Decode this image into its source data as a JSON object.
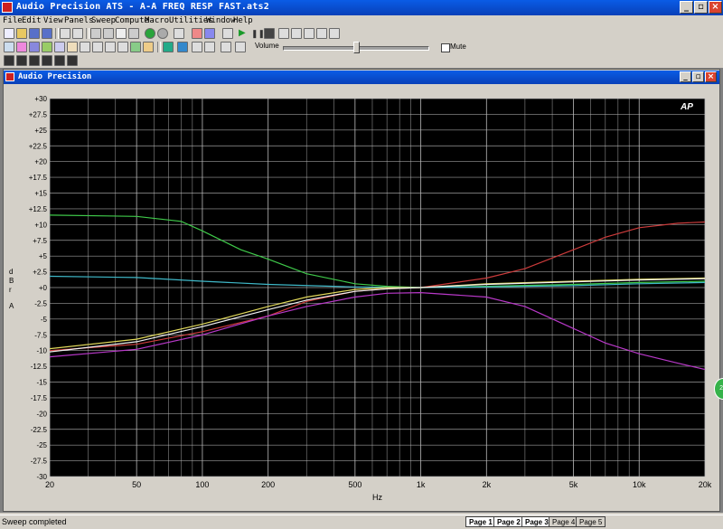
{
  "window": {
    "title": "Audio Precision ATS - A-A FREQ RESP FAST.ats2"
  },
  "menu": [
    "File",
    "Edit",
    "View",
    "Panels",
    "Sweep",
    "Compute",
    "Macro",
    "Utilities",
    "Window",
    "Help"
  ],
  "toolbar": {
    "volume_label": "Volume",
    "volume_level": 0.5,
    "mute_label": "Mute"
  },
  "child_window": {
    "title": "Audio Precision",
    "logo": "AP"
  },
  "status": {
    "text": "Sweep completed",
    "pages": [
      "Page 1",
      "Page 2",
      "Page 3",
      "Page 4",
      "Page 5"
    ],
    "active_page": "Page 1"
  },
  "side_badge": "25",
  "chart_data": {
    "type": "line",
    "xlabel": "Hz",
    "ylabel": "d B r A",
    "xscale": "log",
    "xlim": [
      20,
      20000
    ],
    "ylim": [
      -30,
      30
    ],
    "xticks": [
      {
        "v": 20,
        "label": "20"
      },
      {
        "v": 50,
        "label": "50"
      },
      {
        "v": 100,
        "label": "100"
      },
      {
        "v": 200,
        "label": "200"
      },
      {
        "v": 500,
        "label": "500"
      },
      {
        "v": 1000,
        "label": "1k"
      },
      {
        "v": 2000,
        "label": "2k"
      },
      {
        "v": 5000,
        "label": "5k"
      },
      {
        "v": 10000,
        "label": "10k"
      },
      {
        "v": 20000,
        "label": "20k"
      }
    ],
    "yticks": [
      "+30",
      "+27.5",
      "+25",
      "+22.5",
      "+20",
      "+17.5",
      "+15",
      "+12.5",
      "+10",
      "+7.5",
      "+5",
      "+2.5",
      "+0",
      "-2.5",
      "-5",
      "-7.5",
      "-10",
      "-12.5",
      "-15",
      "-17.5",
      "-20",
      "-22.5",
      "-25",
      "-27.5",
      "-30"
    ],
    "grid": true,
    "background": "#000000",
    "gridcolor": "#b9b9b9",
    "series": [
      {
        "color": "#3fc94a",
        "x": [
          20,
          50,
          80,
          100,
          150,
          200,
          300,
          500,
          700,
          1000,
          2000,
          5000,
          10000,
          20000
        ],
        "y": [
          11.5,
          11.3,
          10.5,
          9,
          6,
          4.5,
          2.2,
          0.6,
          0.2,
          0,
          0.2,
          0.5,
          0.8,
          1.0
        ]
      },
      {
        "color": "#3fb8c8",
        "x": [
          20,
          50,
          100,
          200,
          500,
          1000,
          2000,
          5000,
          10000,
          20000
        ],
        "y": [
          1.8,
          1.6,
          1.0,
          0.5,
          0.1,
          0,
          0.1,
          0.3,
          0.6,
          0.8
        ]
      },
      {
        "color": "#cc3b3b",
        "x": [
          20,
          50,
          100,
          200,
          300,
          500,
          700,
          1000,
          2000,
          3000,
          5000,
          7000,
          10000,
          15000,
          20000
        ],
        "y": [
          -10,
          -9,
          -7,
          -4.5,
          -2.2,
          -0.6,
          -0.2,
          0,
          1.5,
          3,
          6,
          8,
          9.5,
          10.2,
          10.4
        ]
      },
      {
        "color": "#e0d85a",
        "x": [
          20,
          50,
          100,
          200,
          300,
          500,
          700,
          1000,
          2000,
          5000,
          10000,
          20000
        ],
        "y": [
          -9.7,
          -8.2,
          -5.8,
          -3,
          -1.5,
          -0.3,
          0,
          0,
          0.6,
          1.0,
          1.3,
          1.5
        ]
      },
      {
        "color": "#f0f0f0",
        "x": [
          20,
          50,
          100,
          200,
          300,
          500,
          700,
          1000,
          2000,
          5000,
          10000,
          20000
        ],
        "y": [
          -10.2,
          -8.6,
          -6.2,
          -3.5,
          -2,
          -0.6,
          -0.2,
          0,
          0.5,
          0.9,
          1.2,
          1.4
        ]
      },
      {
        "color": "#b838c8",
        "x": [
          20,
          50,
          100,
          200,
          300,
          500,
          700,
          1000,
          2000,
          3000,
          5000,
          7000,
          10000,
          15000,
          20000
        ],
        "y": [
          -11,
          -9.8,
          -7.5,
          -4.5,
          -3,
          -1.5,
          -0.9,
          -0.8,
          -1.5,
          -3,
          -6.5,
          -8.8,
          -10.5,
          -12,
          -13
        ]
      }
    ]
  }
}
